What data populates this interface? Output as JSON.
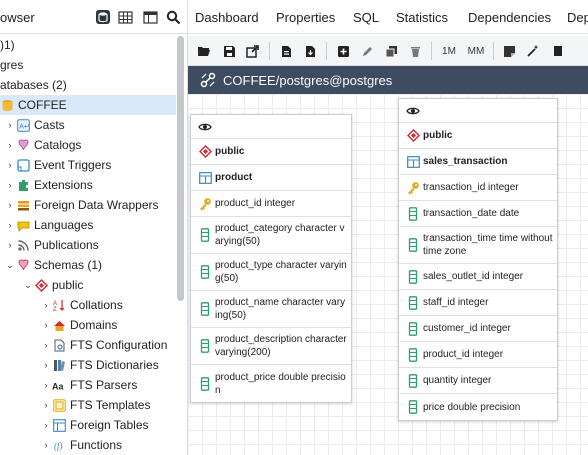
{
  "browser": {
    "title": "owser",
    "buttons": [
      "object-explorer-icon",
      "grid-icon",
      "table-view-icon",
      "search-icon"
    ],
    "tree": [
      {
        "label": ")1)",
        "level": 0,
        "arrow": "",
        "icon": ""
      },
      {
        "label": "gres",
        "level": 0,
        "arrow": "",
        "icon": ""
      },
      {
        "label": "atabases (2)",
        "level": 0,
        "arrow": "",
        "icon": ""
      },
      {
        "label": "COFFEE",
        "level": 0,
        "arrow": "",
        "icon": "database-icon",
        "selected": true
      },
      {
        "label": "Casts",
        "level": 1,
        "arrow": "›",
        "icon": "cast-icon"
      },
      {
        "label": "Catalogs",
        "level": 1,
        "arrow": "›",
        "icon": "catalog-icon"
      },
      {
        "label": "Event Triggers",
        "level": 1,
        "arrow": "›",
        "icon": "event-trigger-icon"
      },
      {
        "label": "Extensions",
        "level": 1,
        "arrow": "›",
        "icon": "extension-icon"
      },
      {
        "label": "Foreign Data Wrappers",
        "level": 1,
        "arrow": "›",
        "icon": "fdw-icon"
      },
      {
        "label": "Languages",
        "level": 1,
        "arrow": "›",
        "icon": "language-icon"
      },
      {
        "label": "Publications",
        "level": 1,
        "arrow": "›",
        "icon": "publication-icon"
      },
      {
        "label": "Schemas (1)",
        "level": 1,
        "arrow": "⌄",
        "icon": "schema-icon"
      },
      {
        "label": "public",
        "level": 2,
        "arrow": "⌄",
        "icon": "public-schema-icon"
      },
      {
        "label": "Collations",
        "level": 3,
        "arrow": "›",
        "icon": "collation-icon"
      },
      {
        "label": "Domains",
        "level": 3,
        "arrow": "›",
        "icon": "domain-icon"
      },
      {
        "label": "FTS Configuration",
        "level": 3,
        "arrow": "›",
        "icon": "fts-config-icon"
      },
      {
        "label": "FTS Dictionaries",
        "level": 3,
        "arrow": "›",
        "icon": "fts-dictionary-icon"
      },
      {
        "label": "FTS Parsers",
        "level": 3,
        "arrow": "›",
        "icon": "fts-parser-icon"
      },
      {
        "label": "FTS Templates",
        "level": 3,
        "arrow": "›",
        "icon": "fts-template-icon"
      },
      {
        "label": "Foreign Tables",
        "level": 3,
        "arrow": "›",
        "icon": "foreign-table-icon"
      },
      {
        "label": "Functions",
        "level": 3,
        "arrow": "›",
        "icon": "function-icon"
      }
    ]
  },
  "tabs": [
    "Dashboard",
    "Properties",
    "SQL",
    "Statistics",
    "Dependencies",
    "Dep"
  ],
  "erd": {
    "toolbar_text": [
      "1M",
      "MM"
    ],
    "title": "COFFEE/postgres@postgres",
    "tables": [
      {
        "schema": "public",
        "name": "product",
        "columns": [
          {
            "text": "product_id integer",
            "key": true
          },
          {
            "text": "product_category character varying(50)"
          },
          {
            "text": "product_type character varying(50)"
          },
          {
            "text": "product_name character varying(50)"
          },
          {
            "text": "product_description character varying(200)"
          },
          {
            "text": "product_price double precision"
          }
        ]
      },
      {
        "schema": "public",
        "name": "sales_transaction",
        "columns": [
          {
            "text": "transaction_id integer",
            "key": true
          },
          {
            "text": "transaction_date date"
          },
          {
            "text": "transaction_time time without time zone"
          },
          {
            "text": "sales_outlet_id integer"
          },
          {
            "text": "staff_id integer"
          },
          {
            "text": "customer_id integer"
          },
          {
            "text": "product_id integer"
          },
          {
            "text": "quantity integer"
          },
          {
            "text": "price double precision"
          }
        ]
      }
    ]
  },
  "colors": {
    "accent": "#326690",
    "selected_row": "#dae8fb",
    "erd_header": "#3e4c62",
    "key_icon": "#e6a817",
    "column_icon": "#2e9e6a",
    "schema_icon": "#d8262f",
    "table_icon": "#3a86c8"
  }
}
